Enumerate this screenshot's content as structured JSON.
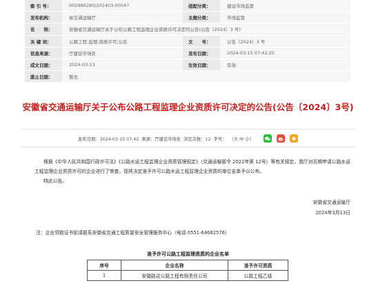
{
  "meta": {
    "index_label": "索 引 号：",
    "index_value": "002986280/202403-00047",
    "category_label": "组配分类：",
    "category_value": "建设市场监管",
    "publisher_label": "发布机构：",
    "publisher_value": "省交通运输厅",
    "topic_label": "主题分类：",
    "topic_value": "市场监管",
    "name_label": "名　　称：",
    "name_value": "安徽省交通运输厅关于公布公路工程监理企业资质许可决定的公告(公告〔2024〕3 号)",
    "keywords_label": "关 键 词：",
    "keywords_value": "公路工程;监理;资质许可;公告",
    "docno_label": "文　　号：",
    "docno_value": "公告〔2024〕3 号",
    "source_label": "信息来源：",
    "source_value": "厅建设市场处",
    "pubdate_label": "发布日期：",
    "pubdate_value": "2024-03-15 07:42:25",
    "written_label": "成文日期：",
    "written_value": "2024-03-13",
    "effective_label": "生效日期：",
    "effective_value": "有效",
    "abolish_label": "废止日期：",
    "abolish_value": "暂无"
  },
  "title": "安徽省交通运输厅关于公布公路工程监理企业资质许可决定的公告(公告〔2024〕3号)",
  "info": {
    "date_text": "发布日期：2024-03-15 07:42",
    "source_text": "来源：厅建设市场处",
    "views_label": "浏览次数：",
    "views_value": "12",
    "fontsize_label": "字号：",
    "fontsize_options": "〔大 中 小〕"
  },
  "share": {
    "wechat_color": "#2dbd3b",
    "weibo_color": "#e6503c",
    "qzone_color": "#f5a623"
  },
  "body": {
    "para1": "根据《中华人民共和国行政许可法》《公路水运工程监理企业资质管理规定》（交通运输部令 2022年第 12号）等有关规定，我厅对近期申请公路水运工程监理企业资质许可的企业进行了审查。现将决定准予许可公路水运工程监理企业资质的单位名单予以公布。",
    "para2": "特此公告。",
    "signer": "安徽省交通运输厅",
    "sign_date": "2024年3月13日",
    "note": "注：企业领取证书前请联系安徽省交通工程质量安全管理服务中心（电话 0551-64682576）"
  },
  "table": {
    "title": "准予许可公路工程监理资质的企业名单",
    "headers": [
      "序号",
      "企业名称",
      "准予许可资质"
    ],
    "rows": [
      [
        "1",
        "安徽路达公路工程有限责任公司",
        "公路工程乙级"
      ]
    ]
  }
}
